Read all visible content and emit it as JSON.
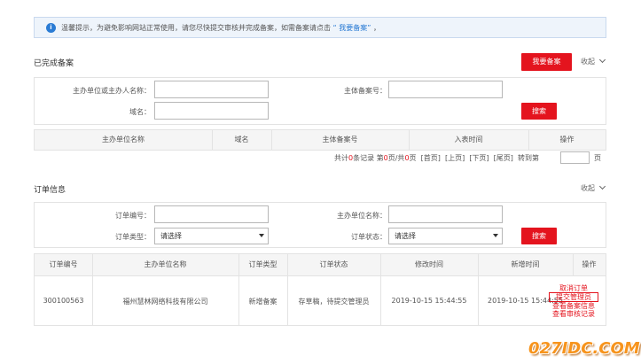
{
  "notice": {
    "text": "温馨提示，为避免影响网站正常使用，请您尽快提交审核并完成备案，如需备案请点击",
    "link_text": "“ 我要备案”",
    "suffix": "，"
  },
  "completed": {
    "title": "已完成备案",
    "register_button": "我要备案",
    "collapse_label": "收起",
    "search": {
      "owner_label": "主办单位或主办人名称：",
      "record_no_label": "主体备案号：",
      "domain_label": "域名：",
      "search_button": "搜索"
    },
    "columns": [
      "主办单位名称",
      "域名",
      "主体备案号",
      "入表时间",
      "操作"
    ],
    "pager": {
      "prefix": "共计",
      "count": "0",
      "mid1": "条记录 第",
      "page": "0",
      "mid2": "页/共",
      "pages": "0",
      "mid3": "页",
      "first": "[首页]",
      "prev": "[上页]",
      "next": "[下页]",
      "last": "[尾页]",
      "jump_to": "转到第",
      "page_unit": "页"
    }
  },
  "orders": {
    "title": "订单信息",
    "collapse_label": "收起",
    "search": {
      "order_no_label": "订单编号：",
      "owner_label": "主办单位名称：",
      "type_label": "订单类型：",
      "type_value": "请选择",
      "status_label": "订单状态：",
      "status_value": "请选择",
      "search_button": "搜索"
    },
    "columns": [
      "订单编号",
      "主办单位名称",
      "订单类型",
      "订单状态",
      "修改时间",
      "新增时间",
      "操作"
    ],
    "rows": [
      {
        "order_no": "300100563",
        "owner": "福州慧林网络科技有限公司",
        "type": "新增备案",
        "status": "存草稿，待提交管理员",
        "modified": "2019-10-15 15:44:55",
        "created": "2019-10-15 15:44:55",
        "actions": [
          "取消订单",
          "提交管理员",
          "查看备案信息",
          "查看审核记录"
        ]
      }
    ]
  },
  "watermark": {
    "brand": "027IDC.COM"
  },
  "colors": {
    "accent_red": "#e4141e",
    "info_blue": "#2a7bd4",
    "watermark_orange": "#f7941d"
  }
}
